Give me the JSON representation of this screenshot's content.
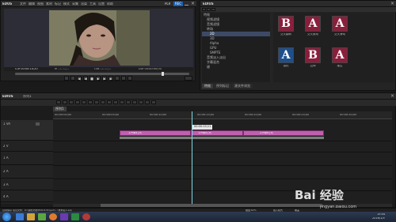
{
  "player": {
    "app_name": "EDUS",
    "menu": [
      "文件",
      "编辑",
      "视图",
      "素材",
      "标记",
      "模式",
      "采集",
      "渲染",
      "工具",
      "设置",
      "帮助"
    ],
    "mode_label": "PLR",
    "rec_label": "REC",
    "timecodes": {
      "cur": "Cur 00:00:10;20",
      "in": "In --:--:--;--",
      "out": "Out --:--:--;--",
      "dur": "Dur 00:00:00;00"
    }
  },
  "bin": {
    "app_name": "EDIUS",
    "tree_header": "特效",
    "tree": [
      "视频滤镜",
      "音频滤镜",
      "转场",
      "2D",
      "3D",
      "Alpha",
      "GPU",
      "SMPTE",
      "音频淡入淡出",
      "字幕混合",
      "键"
    ],
    "effects": [
      {
        "label": "交叉翻转",
        "letter": "B",
        "color": "#8a1f3c"
      },
      {
        "label": "交叉推动",
        "letter": "A",
        "color": "#8a1f3c"
      },
      {
        "label": "交叉滑动",
        "letter": "A",
        "color": "#8a1f3c"
      },
      {
        "label": "溶化",
        "letter": "A",
        "color": "#1f4f8a"
      },
      {
        "label": "拉伸",
        "letter": "B",
        "color": "#8a1f3c"
      },
      {
        "label": "推拉",
        "letter": "A",
        "color": "#8a1f3c"
      }
    ],
    "tabs": [
      "特效",
      "序列标记",
      "源文件浏览"
    ]
  },
  "timeline": {
    "app_name": "EDIUS",
    "sequence": "序列1",
    "sequence_tab": "序列1",
    "ruler_ticks": [
      "00:00:00;00",
      "00:00:05;00",
      "00:00:10;00",
      "00:00:15;00",
      "00:00:20;00",
      "00:00:25;00",
      "00:00:30;00"
    ],
    "cursor_time": "00:00:15;11",
    "tracks": [
      "1 VA",
      "2 V",
      "1 A",
      "2 A",
      "3 A",
      "4 A"
    ],
    "clips": [
      "1.mp4 [V]",
      "1.mp4 [V]",
      "2.mp4 [V]"
    ]
  },
  "status": {
    "left": "自动保存  项目文件：D:\\我的文档\\EDIUS Project\\...\\未命名1.ezp",
    "disk": "磁盘:62%",
    "insert": "插入模式",
    "overwrite": "覆盖"
  },
  "taskbar": {
    "time": "15:04",
    "date": "2016/1/5"
  },
  "watermark": {
    "text": "Bai 经验",
    "url": "jingyan.baidu.com"
  }
}
